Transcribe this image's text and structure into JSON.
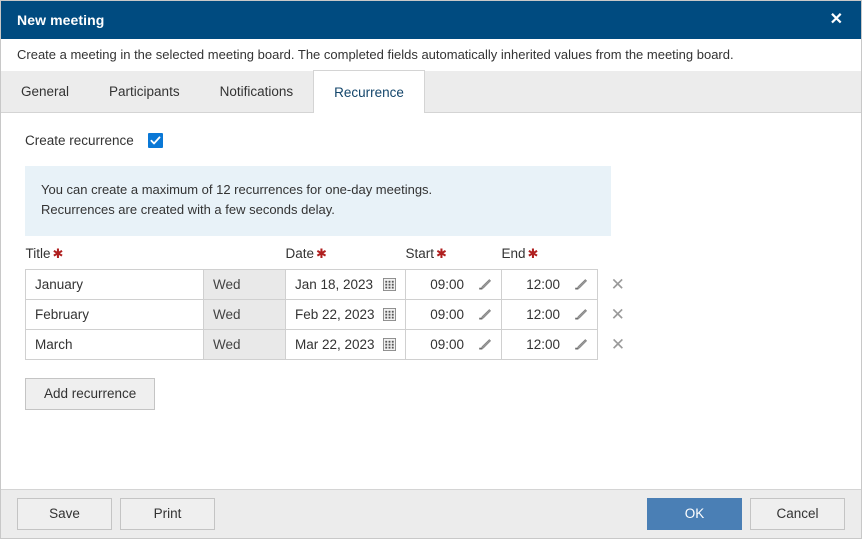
{
  "window": {
    "title": "New meeting",
    "close_icon": "close-icon",
    "subtitle": "Create a meeting in the selected meeting board. The completed fields automatically inherited values from the meeting board."
  },
  "colors": {
    "titlebar_bg": "#004b80",
    "accent_checkbox": "#0a78d6",
    "primary_button": "#4a7fb5",
    "info_bg": "#e8f2f8",
    "required_star": "#b02020",
    "active_tab_text": "#14466b"
  },
  "tabs": [
    {
      "label": "General",
      "active": false
    },
    {
      "label": "Participants",
      "active": false
    },
    {
      "label": "Notifications",
      "active": false
    },
    {
      "label": "Recurrence",
      "active": true
    }
  ],
  "recurrence": {
    "create_label": "Create recurrence",
    "create_checked": true,
    "info_lines": [
      "You can create a maximum of 12 recurrences for one-day meetings.",
      "Recurrences are created with a few seconds delay."
    ],
    "columns": [
      {
        "label": "Title",
        "required": true
      },
      {
        "label": "Date",
        "required": true
      },
      {
        "label": "Start",
        "required": true
      },
      {
        "label": "End",
        "required": true
      }
    ],
    "rows": [
      {
        "title": "January",
        "day": "Wed",
        "date": "Jan 18, 2023",
        "start": "09:00",
        "end": "12:00"
      },
      {
        "title": "February",
        "day": "Wed",
        "date": "Feb 22, 2023",
        "start": "09:00",
        "end": "12:00"
      },
      {
        "title": "March",
        "day": "Wed",
        "date": "Mar 22, 2023",
        "start": "09:00",
        "end": "12:00"
      }
    ],
    "row_icons": {
      "date_picker": "calendar-icon",
      "time_edit": "pencil-icon",
      "delete": "delete-x-icon"
    },
    "add_button": "Add recurrence"
  },
  "footer": {
    "save": "Save",
    "print": "Print",
    "ok": "OK",
    "cancel": "Cancel"
  }
}
